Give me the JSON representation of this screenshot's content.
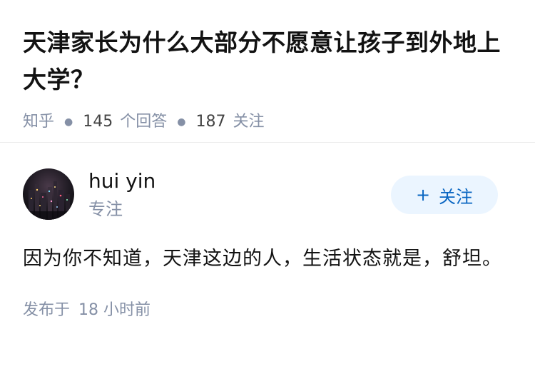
{
  "question": {
    "title": "天津家长为什么大部分不愿意让孩子到外地上大学？",
    "source": "知乎",
    "answer_count": "145",
    "answer_label": "个回答",
    "follow_count": "187",
    "follow_label": "关注"
  },
  "answer": {
    "author": {
      "name": "hui yin",
      "subtitle": "专注",
      "avatar_icon": "avatar-icon"
    },
    "follow_button": {
      "plus": "+",
      "label": "关注"
    },
    "content": "因为你不知道，天津这边的人，生活状态就是，舒坦。",
    "published_label": "发布于",
    "published_time": "18 小时前"
  },
  "colors": {
    "title": "#121212",
    "muted": "#8590a6",
    "accent": "#0a66c2",
    "button_bg": "#ebf5ff"
  }
}
